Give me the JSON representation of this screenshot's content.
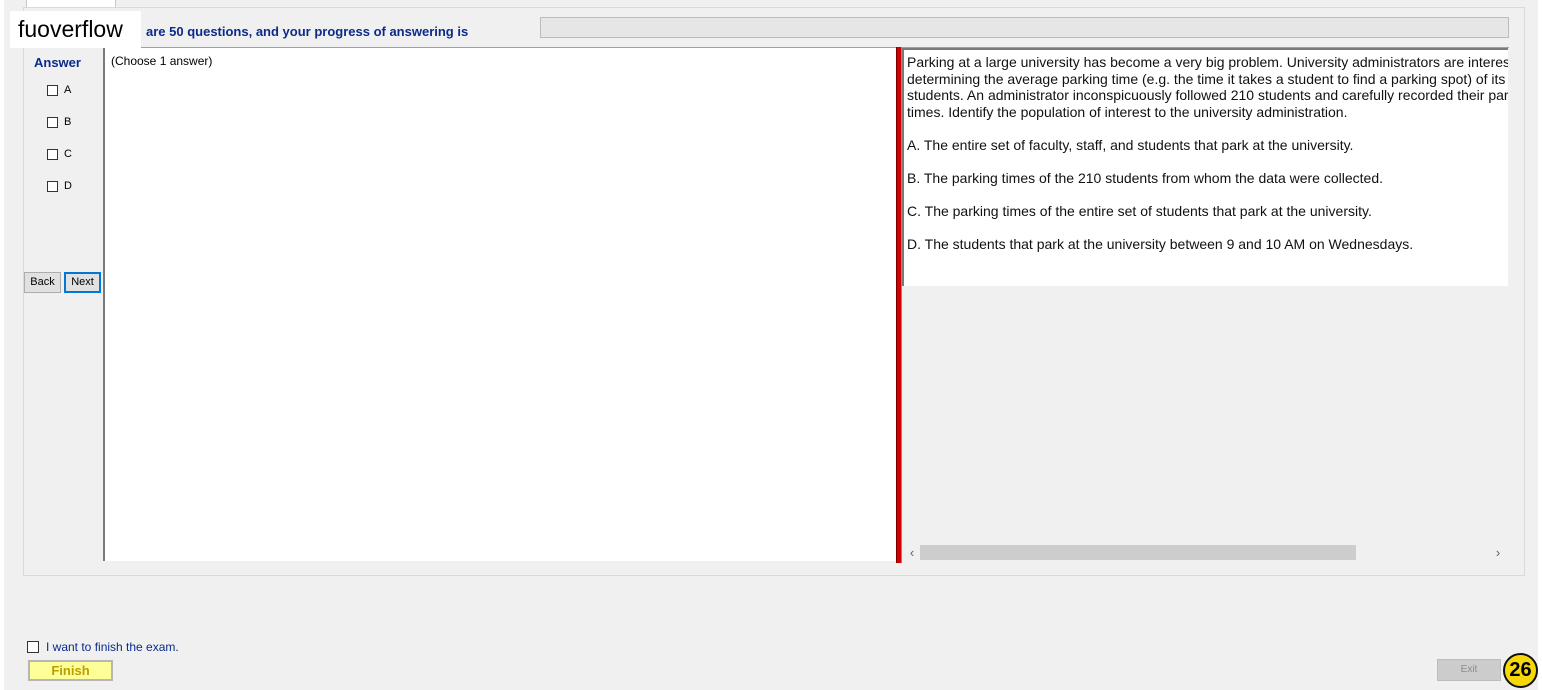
{
  "watermark": "fuoverflow",
  "header": {
    "progress_text": "are 50 questions, and your progress of answering is",
    "progress_percent": 0
  },
  "answer_panel": {
    "heading": "Answer",
    "options": [
      "A",
      "B",
      "C",
      "D"
    ],
    "back_label": "Back",
    "next_label": "Next"
  },
  "answer_area": {
    "instruction": "(Choose 1 answer)"
  },
  "question": {
    "text": "Parking at a large university has become a very big problem. University administrators are interested in determining the average parking time (e.g. the time it takes a student to find a parking spot) of its students. An administrator inconspicuously followed 210 students and carefully recorded their parking times. Identify the population of interest to the university administration.",
    "choices": [
      "A.  The entire set of faculty, staff, and students that park at the university.",
      "B.  The parking times of the 210 students from whom the data were collected.",
      "C.  The parking times of the entire set of students that park at the university.",
      "D.  The students that park at the university between 9 and 10 AM on Wednesdays."
    ]
  },
  "scrollbar": {
    "left_arrow": "‹",
    "right_arrow": "›"
  },
  "footer": {
    "finish_checkbox_label": "I want to finish the exam.",
    "finish_label": "Finish",
    "exit_label": "Exit",
    "badge_number": "26"
  },
  "colors": {
    "heading_blue": "#0b2a8a",
    "splitter_red": "#d40000",
    "finish_yellow": "#ffff99",
    "badge_yellow": "#f6d80a"
  }
}
